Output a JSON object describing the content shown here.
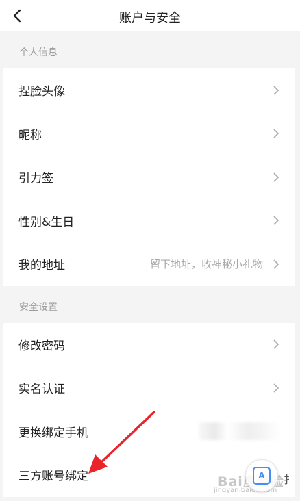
{
  "header": {
    "title": "账户与安全"
  },
  "sections": [
    {
      "title": "个人信息",
      "items": [
        {
          "label": "捏脸头像"
        },
        {
          "label": "昵称"
        },
        {
          "label": "引力签"
        },
        {
          "label": "性别&生日"
        },
        {
          "label": "我的地址",
          "hint": "留下地址，收神秘小礼物"
        }
      ]
    },
    {
      "title": "安全设置",
      "items": [
        {
          "label": "修改密码"
        },
        {
          "label": "实名认证"
        },
        {
          "label": "更换绑定手机"
        },
        {
          "label": "三方账号绑定"
        }
      ]
    }
  ],
  "watermark": {
    "text": "Bai度经验",
    "sub": "jingyan.baidu.com",
    "icon_letter": "A",
    "edge_char": "扌"
  },
  "colors": {
    "background": "#f4f4f4",
    "row_bg": "#ffffff",
    "section_text": "#9a9a9a",
    "hint_text": "#a8a8a8",
    "annotation_arrow": "#e8252a"
  }
}
